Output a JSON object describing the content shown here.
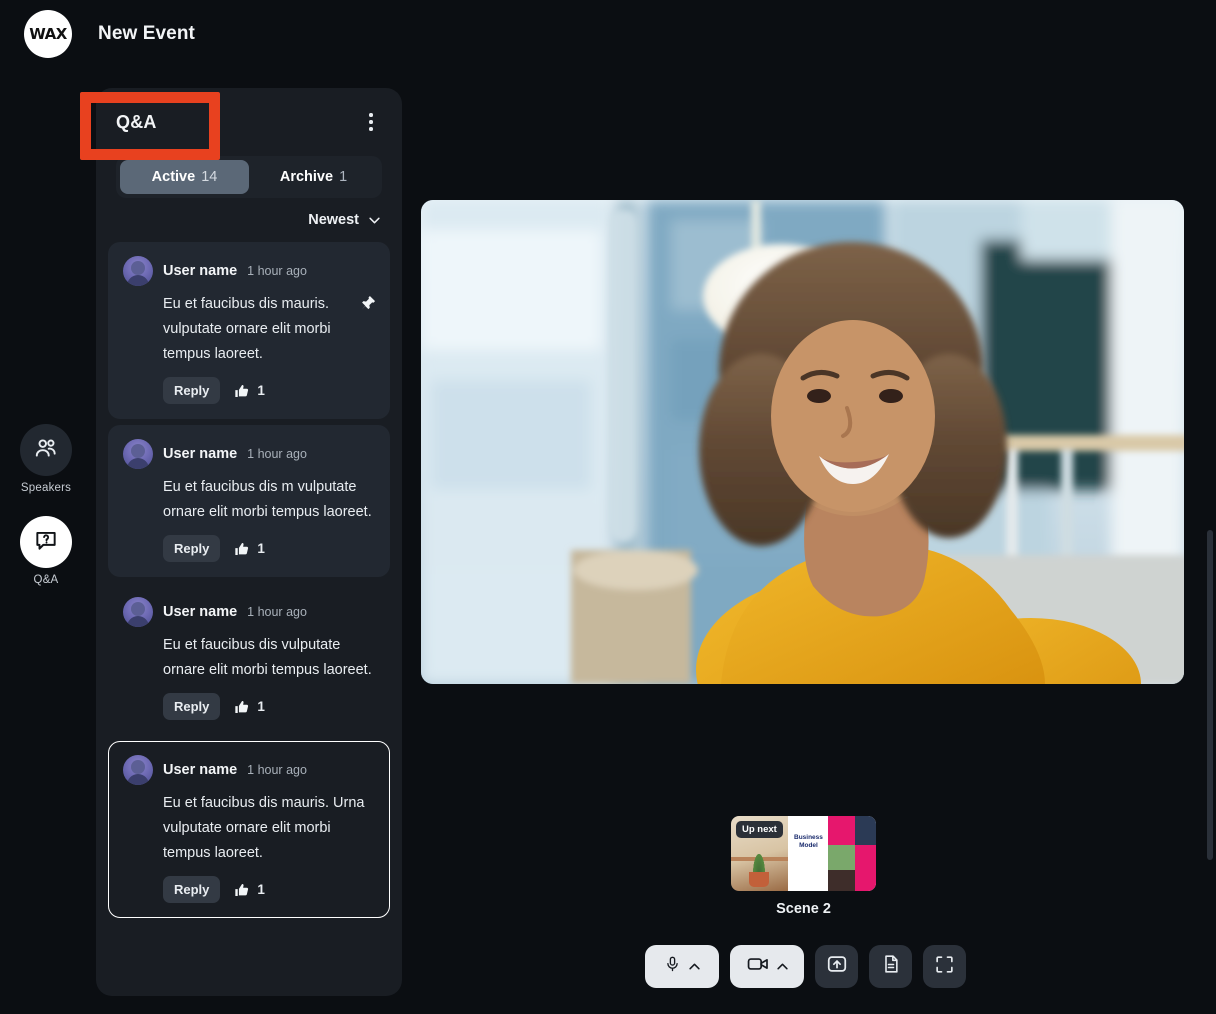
{
  "app": {
    "logo_text": "WAX",
    "event_title": "New Event"
  },
  "rail": {
    "items": [
      {
        "id": "speakers",
        "label": "Speakers",
        "icon": "people-icon",
        "active": false
      },
      {
        "id": "qa",
        "label": "Q&A",
        "icon": "question-bubble-icon",
        "active": true
      }
    ]
  },
  "qa_panel": {
    "title": "Q&A",
    "menu_icon": "kebab-menu-icon",
    "tabs": [
      {
        "label": "Active",
        "count": "14",
        "selected": true
      },
      {
        "label": "Archive",
        "count": "1",
        "selected": false
      }
    ],
    "sort": {
      "label": "Newest",
      "icon": "chevron-down-icon"
    },
    "questions": [
      {
        "user": "User name",
        "time": "1 hour ago",
        "text": "Eu et faucibus dis mauris. vulputate ornare elit morbi tempus laoreet.",
        "reply_label": "Reply",
        "likes": "1",
        "pinned": true,
        "raised": true,
        "focused": false
      },
      {
        "user": "User name",
        "time": "1 hour ago",
        "text": "Eu et faucibus dis m vulputate ornare elit morbi tempus laoreet.",
        "reply_label": "Reply",
        "likes": "1",
        "pinned": false,
        "raised": true,
        "focused": false
      },
      {
        "user": "User name",
        "time": "1 hour ago",
        "text": "Eu et faucibus dis vulputate ornare elit morbi tempus laoreet.",
        "reply_label": "Reply",
        "likes": "1",
        "pinned": false,
        "raised": false,
        "focused": false
      },
      {
        "user": "User name",
        "time": "1 hour ago",
        "text": "Eu et faucibus dis mauris. Urna vulputate ornare elit morbi tempus laoreet.",
        "reply_label": "Reply",
        "likes": "1",
        "pinned": false,
        "raised": false,
        "focused": true
      }
    ]
  },
  "stage": {
    "scene": {
      "badge": "Up next",
      "label": "Scene 2",
      "slide_title": "Business\nModel"
    },
    "controls": [
      {
        "id": "microphone",
        "icon": "microphone-icon",
        "style": "pill",
        "has_carat": true
      },
      {
        "id": "camera",
        "icon": "video-camera-icon",
        "style": "pill",
        "has_carat": true
      },
      {
        "id": "share-screen",
        "icon": "share-screen-icon",
        "style": "square",
        "has_carat": false
      },
      {
        "id": "notes",
        "icon": "document-icon",
        "style": "square",
        "has_carat": false
      },
      {
        "id": "fullscreen",
        "icon": "fullscreen-icon",
        "style": "square",
        "has_carat": false
      }
    ]
  },
  "annotation": {
    "target": "Q&A",
    "color": "#e8411f"
  }
}
